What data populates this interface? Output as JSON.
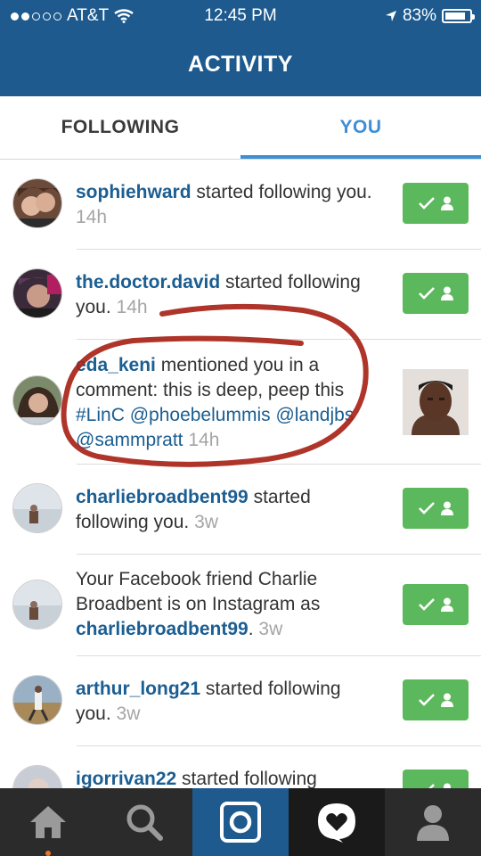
{
  "status_bar": {
    "carrier": "AT&T",
    "time": "12:45 PM",
    "battery": "83%",
    "signal_bars_filled": 2,
    "signal_bars_total": 5
  },
  "header": {
    "title": "ACTIVITY"
  },
  "tabs": [
    {
      "label": "FOLLOWING",
      "selected": false
    },
    {
      "label": "YOU",
      "selected": true
    }
  ],
  "colors": {
    "nav_bar": "#1e5a8e",
    "username": "#1b5e92",
    "active_tab": "#3d8fd6",
    "follow_button": "#5cb85c",
    "annotation_ink": "#a82418"
  },
  "notifications": [
    {
      "username": "sophiehward",
      "message": " started following you.",
      "time": "14h",
      "action": "following-button"
    },
    {
      "username": "the.doctor.david",
      "message": " started following you.",
      "time": "14h",
      "action": "following-button"
    },
    {
      "username": "eda_keni",
      "message": " mentioned you in a comment: this is deep, peep this ",
      "mentions": [
        "#LinC",
        "@phoebelummis",
        "@landjbs",
        "@sammpratt"
      ],
      "time": "14h",
      "action": "post-thumbnail"
    },
    {
      "username": "charliebroadbent99",
      "message": " started following you.",
      "time": "3w",
      "action": "following-button"
    },
    {
      "prefix": "Your Facebook friend Charlie Broadbent is on Instagram as ",
      "username": "charliebroadbent99",
      "message": ".",
      "time": "3w",
      "action": "following-button"
    },
    {
      "username": "arthur_long21",
      "message": " started following you.",
      "time": "3w",
      "action": "following-button"
    },
    {
      "username": "igorrivan22",
      "message": " started following",
      "time": "",
      "action": "following-button"
    }
  ],
  "bottom_tabs": [
    {
      "icon": "home-icon",
      "active": false
    },
    {
      "icon": "search-icon",
      "active": false
    },
    {
      "icon": "camera-icon",
      "active": false
    },
    {
      "icon": "activity-icon",
      "active": true
    },
    {
      "icon": "profile-icon",
      "active": false
    }
  ]
}
